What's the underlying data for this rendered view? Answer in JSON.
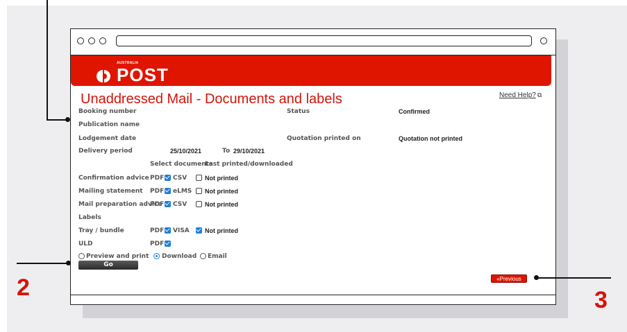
{
  "header": {
    "logo_small": "AUSTRALIA",
    "logo_big": "POST"
  },
  "page": {
    "title": "Unaddressed Mail - Documents and labels",
    "help_link": "Need Help?",
    "help_icon": "external-link-icon"
  },
  "fields": {
    "booking_number_label": "Booking number",
    "publication_name_label": "Publication name",
    "lodgement_date_label": "Lodgement date",
    "delivery_period_label": "Delivery period",
    "delivery_from": "25/10/2021",
    "delivery_to_label": "To",
    "delivery_to": "29/10/2021",
    "status_label": "Status",
    "status_value": "Confirmed",
    "quotation_label": "Quotation printed on",
    "quotation_value": "Quotation not printed"
  },
  "documents": {
    "col_select": "Select documents",
    "col_last": "Last printed/downloaded",
    "rows": [
      {
        "label": "Confirmation advice",
        "pdf": "PDF",
        "fmt": "CSV",
        "status": "Not printed"
      },
      {
        "label": "Mailing statement",
        "pdf": "PDF",
        "fmt": "eLMS",
        "status": "Not printed"
      },
      {
        "label": "Mail preparation advice",
        "pdf": "PDF",
        "fmt": "CSV",
        "status": "Not printed"
      }
    ],
    "labels_heading": "Labels",
    "label_rows": [
      {
        "label": "Tray / bundle",
        "pdf": "PDF",
        "fmt": "VISA",
        "status": "Not printed"
      },
      {
        "label": "ULD",
        "pdf": "PDF"
      }
    ]
  },
  "output": {
    "preview": "Preview and print",
    "download": "Download",
    "email": "Email",
    "selected": "Download",
    "go_label": "Go"
  },
  "nav": {
    "previous_label": "«Previous"
  },
  "callouts": {
    "left": "2",
    "right": "3"
  }
}
